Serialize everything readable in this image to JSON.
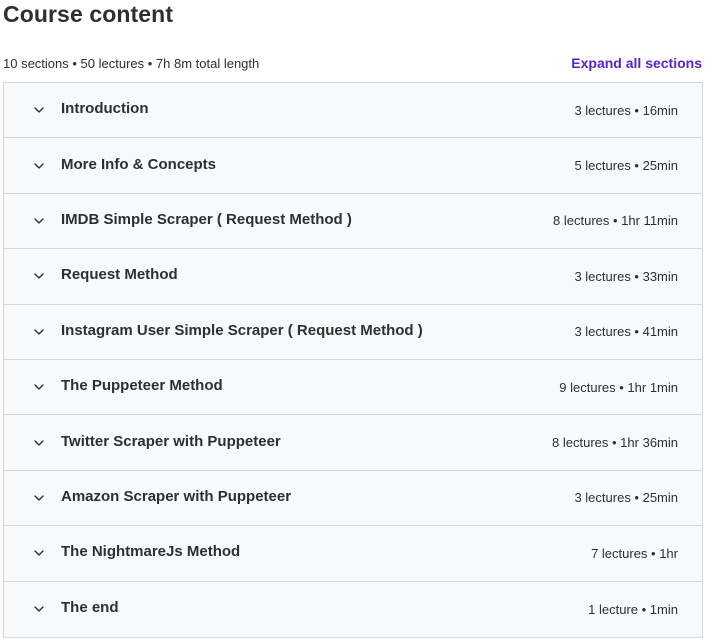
{
  "header": {
    "title": "Course content",
    "summary": "10 sections • 50 lectures • 7h 8m total length",
    "expand_label": "Expand all sections"
  },
  "colors": {
    "accent": "#5624d0",
    "text": "#2d2f31",
    "row_bg": "#f7f9fa",
    "border": "#d1d7dc"
  },
  "sections": [
    {
      "title": "Introduction",
      "meta": "3 lectures • 16min",
      "icon": "chevron-down-icon"
    },
    {
      "title": "More Info & Concepts",
      "meta": "5 lectures • 25min",
      "icon": "chevron-down-icon"
    },
    {
      "title": "IMDB Simple Scraper ( Request Method )",
      "meta": "8 lectures • 1hr 11min",
      "icon": "chevron-down-icon"
    },
    {
      "title": "Request Method",
      "meta": "3 lectures • 33min",
      "icon": "chevron-down-icon"
    },
    {
      "title": "Instagram User Simple Scraper ( Request Method )",
      "meta": "3 lectures • 41min",
      "icon": "chevron-down-icon"
    },
    {
      "title": "The Puppeteer Method",
      "meta": "9 lectures • 1hr 1min",
      "icon": "chevron-down-icon"
    },
    {
      "title": "Twitter Scraper with Puppeteer",
      "meta": "8 lectures • 1hr 36min",
      "icon": "chevron-down-icon"
    },
    {
      "title": "Amazon Scraper with Puppeteer",
      "meta": "3 lectures • 25min",
      "icon": "chevron-down-icon"
    },
    {
      "title": "The NightmareJs Method",
      "meta": "7 lectures • 1hr",
      "icon": "chevron-down-icon"
    },
    {
      "title": "The end",
      "meta": "1 lecture • 1min",
      "icon": "chevron-down-icon"
    }
  ]
}
